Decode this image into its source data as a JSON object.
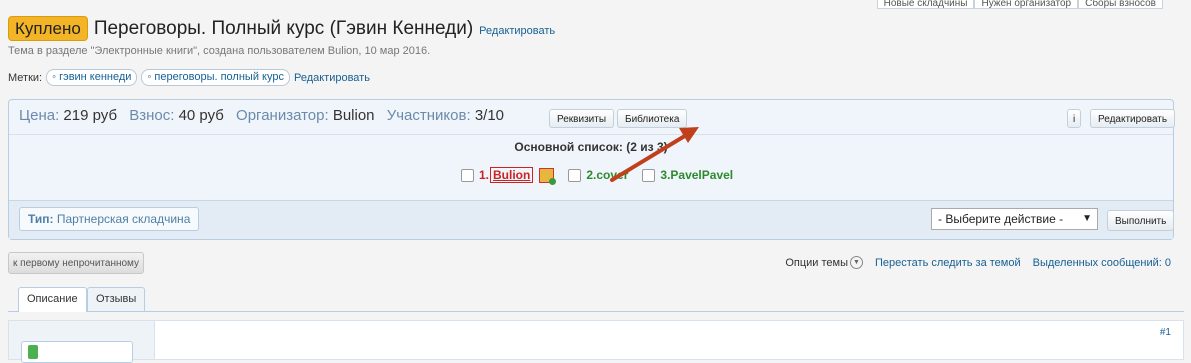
{
  "top_nav": [
    "Новые складчины",
    "Нужен организатор",
    "Сборы взносов"
  ],
  "thread": {
    "status_badge": "Куплено",
    "title": "Переговоры. Полный курс (Гэвин Кеннеди)",
    "edit_link": "Редактировать",
    "meta": "Тема в разделе \"Электронные книги\", создана пользователем Bulion, 10 мар 2016."
  },
  "tags": {
    "label": "Метки:",
    "items": [
      "гэвин кеннеди",
      "переговоры. полный курс"
    ],
    "edit_link": "Редактировать"
  },
  "panel": {
    "price_label": "Цена:",
    "price_value": "219 руб",
    "fee_label": "Взнос:",
    "fee_value": "40 руб",
    "organizer_label": "Организатор:",
    "organizer_value": "Bulion",
    "participants_label": "Участников:",
    "participants_value": "3/10",
    "requisites_button": "Реквизиты",
    "library_button": "Библиотека",
    "info_button": "i",
    "edit_button": "Редактировать",
    "main_list_title": "Основной список: (2 из 3)",
    "members": [
      {
        "num": "1.",
        "name": "Bulion"
      },
      {
        "num": "2.",
        "name": "cover"
      },
      {
        "num": "3.",
        "name": "PavelPavel"
      }
    ],
    "type_label": "Тип:",
    "type_value": "Партнерская складчина",
    "action_select": "- Выберите действие -",
    "execute_button": "Выполнить"
  },
  "toolbar": {
    "first_unread_button": "к первому непрочитанному",
    "thread_options": "Опции темы",
    "stop_watching": "Перестать следить за темой",
    "selected_messages_label": "Выделенных сообщений:",
    "selected_messages_count": "0"
  },
  "tabs": [
    "Описание",
    "Отзывы"
  ],
  "post": {
    "number": "#1"
  },
  "colors": {
    "badge": "#f3b526",
    "link": "#176093",
    "arrow": "#c0401c",
    "member_owner": "#cc2222",
    "member": "#2c8a2c"
  }
}
